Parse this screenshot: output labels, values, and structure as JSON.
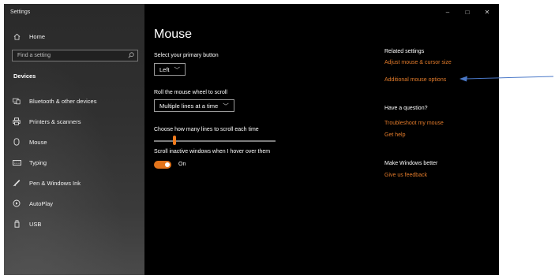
{
  "window": {
    "app_title": "Settings",
    "controls": {
      "minimize": "–",
      "maximize": "□",
      "close": "✕"
    }
  },
  "sidebar": {
    "home_label": "Home",
    "search_placeholder": "Find a setting",
    "section_heading": "Devices",
    "items": [
      {
        "label": "Bluetooth & other devices",
        "icon": "bluetooth-devices-icon"
      },
      {
        "label": "Printers & scanners",
        "icon": "printer-icon"
      },
      {
        "label": "Mouse",
        "icon": "mouse-icon"
      },
      {
        "label": "Typing",
        "icon": "keyboard-icon"
      },
      {
        "label": "Pen & Windows Ink",
        "icon": "pen-icon"
      },
      {
        "label": "AutoPlay",
        "icon": "autoplay-icon"
      },
      {
        "label": "USB",
        "icon": "usb-icon"
      }
    ]
  },
  "main": {
    "title": "Mouse",
    "primary_button": {
      "label": "Select your primary button",
      "value": "Left"
    },
    "scroll_wheel": {
      "label": "Roll the mouse wheel to scroll",
      "value": "Multiple lines at a time"
    },
    "lines_to_scroll": {
      "label": "Choose how many lines to scroll each time",
      "level_fraction": 0.17
    },
    "scroll_inactive": {
      "label": "Scroll inactive windows when I hover over them",
      "state": "On"
    }
  },
  "related": {
    "heading": "Related settings",
    "links": [
      "Adjust mouse & cursor size",
      "Additional mouse options"
    ],
    "question_heading": "Have a question?",
    "question_links": [
      "Troubleshoot my mouse",
      "Get help"
    ],
    "better_heading": "Make Windows better",
    "feedback_link": "Give us feedback"
  },
  "colors": {
    "accent": "#e37b2a",
    "annotation_arrow": "#4a78c8",
    "background": "#000000"
  }
}
